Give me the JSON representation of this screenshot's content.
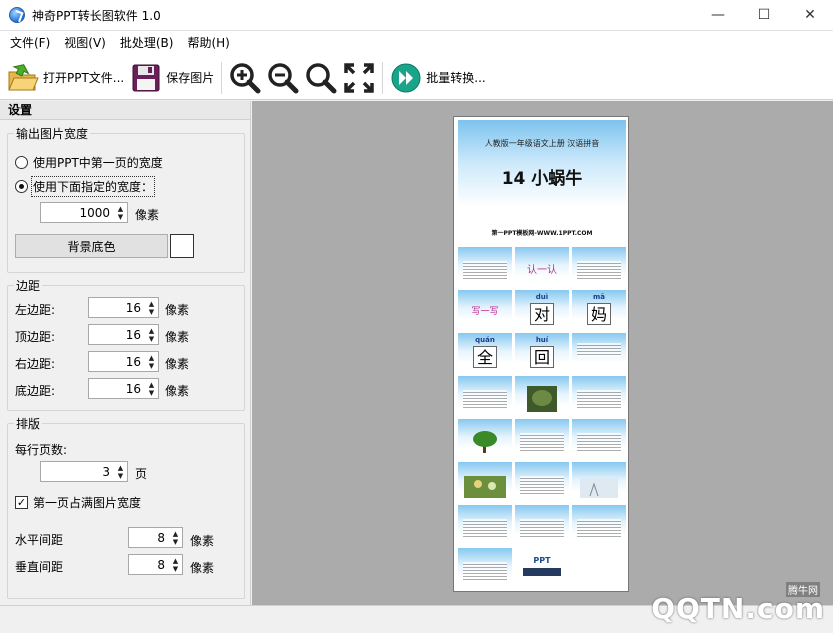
{
  "window": {
    "title": "神奇PPT转长图软件 1.0",
    "minimize": "—",
    "maximize": "☐",
    "close": "✕"
  },
  "menu": [
    {
      "label": "文件(F)"
    },
    {
      "label": "视图(V)"
    },
    {
      "label": "批处理(B)"
    },
    {
      "label": "帮助(H)"
    }
  ],
  "toolbar": {
    "open_label": "打开PPT文件...",
    "save_label": "保存图片",
    "batch_label": "批量转换..."
  },
  "settings": {
    "header": "设置",
    "output_width": {
      "title": "输出图片宽度",
      "option_first_page": "使用PPT中第一页的宽度",
      "option_custom": "使用下面指定的宽度：",
      "width_value": "1000",
      "width_unit": "像素",
      "bg_button": "背景底色",
      "bg_color": "#ffffff"
    },
    "margin": {
      "title": "边距",
      "left_label": "左边距:",
      "left_value": "16",
      "top_label": "顶边距:",
      "top_value": "16",
      "right_label": "右边距:",
      "right_value": "16",
      "bottom_label": "底边距:",
      "bottom_value": "16",
      "unit": "像素"
    },
    "layout": {
      "title": "排版",
      "per_row_label": "每行页数:",
      "per_row_value": "3",
      "per_row_unit": "页",
      "first_full_label": "第一页占满图片宽度",
      "first_full_checked": true,
      "h_gap_label": "水平间距",
      "h_gap_value": "8",
      "v_gap_label": "垂直间距",
      "v_gap_value": "8",
      "unit": "像素"
    }
  },
  "preview": {
    "cover_subtitle": "人教版一年级语文上册   汉语拼音",
    "cover_title": "14 小蜗牛",
    "cover_footer": "第一PPT模板网-WWW.1PPT.COM",
    "chars": [
      {
        "pinyin": "duì",
        "char": "对"
      },
      {
        "pinyin": "mā",
        "char": "妈"
      },
      {
        "pinyin": "quán",
        "char": "全"
      },
      {
        "pinyin": "huí",
        "char": "回"
      }
    ],
    "renren": "认一认",
    "xieyixie": "写一写",
    "watermark_brand": "QQTN.com",
    "watermark_cn": "腾牛网"
  }
}
